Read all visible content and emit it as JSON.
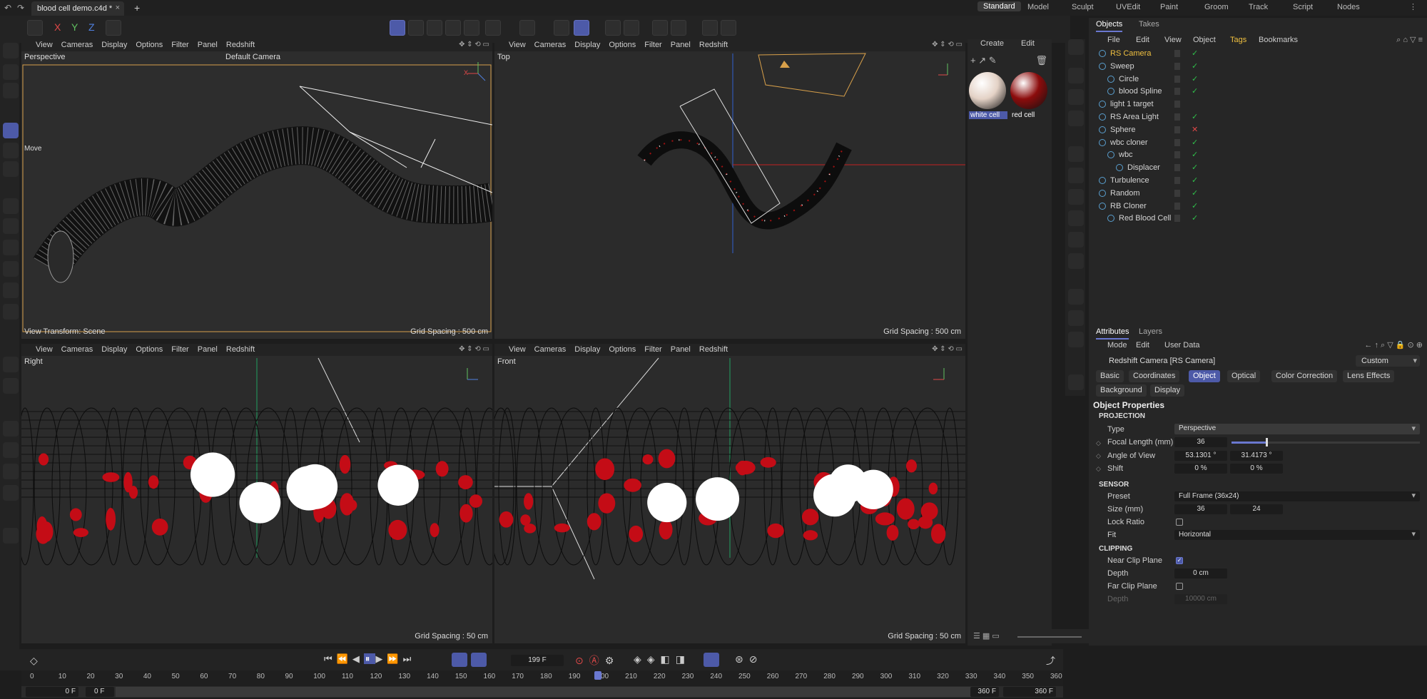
{
  "app": {
    "tab_title": "blood cell demo.c4d *",
    "layouts": [
      "Standard",
      "Model",
      "Sculpt",
      "UVEdit",
      "Paint",
      "Groom",
      "Track",
      "Script",
      "Nodes"
    ],
    "active_layout": "Standard"
  },
  "viewport_menu": [
    "View",
    "Cameras",
    "Display",
    "Options",
    "Filter",
    "Panel",
    "Redshift"
  ],
  "viewports": {
    "perspective": {
      "name": "Perspective",
      "camera": "Default Camera",
      "mode": "Move",
      "footer_left": "View Transform: Scene",
      "grid": "Grid Spacing : 500 cm"
    },
    "top": {
      "name": "Top",
      "grid": "Grid Spacing : 500 cm"
    },
    "right": {
      "name": "Right",
      "grid": "Grid Spacing : 50 cm"
    },
    "front": {
      "name": "Front",
      "grid": "Grid Spacing : 50 cm"
    }
  },
  "materials": {
    "menu": [
      "Create",
      "Edit"
    ],
    "items": [
      {
        "name": "white cell",
        "color": "#e4d2c6"
      },
      {
        "name": "red cell",
        "color": "#8c0c0c"
      }
    ]
  },
  "objects_panel": {
    "tabs": [
      "Objects",
      "Takes"
    ],
    "menu": [
      "File",
      "Edit",
      "View",
      "Object",
      "Tags",
      "Bookmarks"
    ],
    "items": [
      {
        "name": "RS Camera",
        "level": 0,
        "selected": true
      },
      {
        "name": "Sweep",
        "level": 0
      },
      {
        "name": "Circle",
        "level": 1
      },
      {
        "name": "blood Spline",
        "level": 1
      },
      {
        "name": "light 1 target",
        "level": 0
      },
      {
        "name": "RS Area Light",
        "level": 0
      },
      {
        "name": "Sphere",
        "level": 0
      },
      {
        "name": "wbc cloner",
        "level": 0
      },
      {
        "name": "wbc",
        "level": 1
      },
      {
        "name": "Displacer",
        "level": 2
      },
      {
        "name": "Turbulence",
        "level": 0
      },
      {
        "name": "Random",
        "level": 0
      },
      {
        "name": "RB Cloner",
        "level": 0
      },
      {
        "name": "Red Blood Cell",
        "level": 1
      }
    ]
  },
  "attributes": {
    "tabs": [
      "Attributes",
      "Layers"
    ],
    "menu": [
      "Mode",
      "Edit",
      "User Data"
    ],
    "object_name": "Redshift Camera [RS Camera]",
    "preset_mode": "Custom",
    "subtabs": [
      "Basic",
      "Coordinates",
      "Object",
      "Optical",
      "Color Correction",
      "Lens Effects"
    ],
    "subtabs2": [
      "Background",
      "Display"
    ],
    "active_subtab": "Object",
    "section_title": "Object Properties",
    "projection_header": "PROJECTION",
    "type_label": "Type",
    "type_value": "Perspective",
    "focal_label": "Focal Length (mm)",
    "focal_value": "36",
    "focal_slider_fraction": 0.18,
    "aov_label": "Angle of View",
    "aov_h": "53.1301 °",
    "aov_v": "31.4173 °",
    "shift_label": "Shift",
    "shift_x": "0 %",
    "shift_y": "0 %",
    "sensor_header": "SENSOR",
    "preset_label": "Preset",
    "preset_value": "Full Frame (36x24)",
    "size_label": "Size (mm)",
    "size_w": "36",
    "size_h": "24",
    "lock_label": "Lock Ratio",
    "fit_label": "Fit",
    "fit_value": "Horizontal",
    "clipping_header": "CLIPPING",
    "near_label": "Near Clip Plane",
    "depth_label": "Depth",
    "depth_value": "0 cm",
    "far_label": "Far Clip Plane",
    "depth2_label": "Depth",
    "depth2_value": "10000 cm"
  },
  "timeline": {
    "current_frame": "199 F",
    "ticks": [
      "0",
      "10",
      "20",
      "30",
      "40",
      "50",
      "60",
      "70",
      "80",
      "90",
      "100",
      "110",
      "120",
      "130",
      "140",
      "150",
      "160",
      "170",
      "180",
      "190",
      "200",
      "210",
      "220",
      "230",
      "240",
      "250",
      "260",
      "270",
      "280",
      "290",
      "300",
      "310",
      "320",
      "330",
      "340",
      "350",
      "360"
    ],
    "start": "0 F",
    "start2": "0 F",
    "end": "360 F",
    "end2": "360 F",
    "playhead_frame": 199,
    "max_frame": 360
  },
  "colors": {
    "accent": "#4d5aa8",
    "selected_text": "#f0c040",
    "check": "#2fbf4a",
    "red_cell": "#c40c16",
    "white_cell": "#ffffff"
  }
}
